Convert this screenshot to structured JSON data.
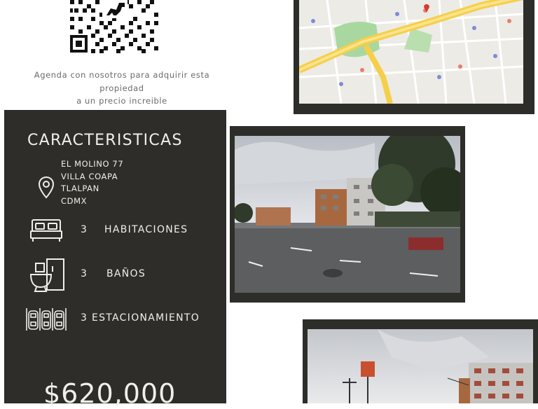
{
  "cta": {
    "line1": "Agenda con nosotros para adquirir esta propiedad",
    "line2": "a un precio increible"
  },
  "features": {
    "title": "CARACTERISTICAS",
    "address": [
      "EL MOLINO 77",
      "VILLA COAPA",
      "TLALPAN",
      "CDMX"
    ],
    "bedrooms": {
      "count": "3",
      "label": "HABITACIONES",
      "icon": "bed-icon"
    },
    "bathrooms": {
      "count": "3",
      "label": "BAÑOS",
      "icon": "bathroom-icon"
    },
    "parking": {
      "label": "3 ESTACIONAMIENTO",
      "icon": "parking-icon"
    },
    "price": "$620,000"
  },
  "colors": {
    "panel": "#2e2d29",
    "frame": "#2d2d2a",
    "text_light": "#f0efe9",
    "caption": "#6a6a6a"
  }
}
